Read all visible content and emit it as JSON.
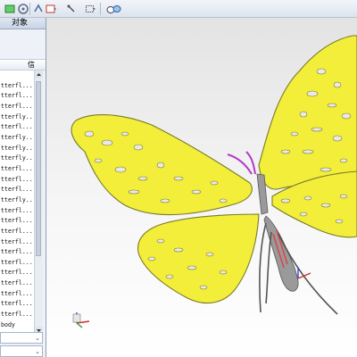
{
  "toolbar": {
    "icons": [
      "snap-icon",
      "orient-icon",
      "zoom-icon",
      "rotate-icon",
      "select-icon",
      "view-icon",
      "render-icon"
    ]
  },
  "navigator": {
    "title": "对象",
    "column_header": "信",
    "rows": [
      "",
      "tterfl...",
      "tterfl...",
      "tterfl...",
      "tterfly...",
      "tterfl...",
      "tterfly...",
      "tterfly...",
      "tterfly...",
      "tterfl...",
      "tterfl...",
      "tterfl...",
      "tterfly...",
      "tterfl...",
      "tterfl...",
      "tterfl...",
      "tterfl...",
      "tterfl...",
      "tterfl...",
      "tterfl...",
      "tterfl...",
      "tterfl...",
      "tterfl...",
      "tterfl...",
      "body"
    ]
  },
  "model": {
    "wing_color": "#f2ee3a",
    "outline_color": "#7b7a2b",
    "body_color": "#9a9a9a",
    "accent_color": "#b23cc8",
    "axis_colors": {
      "x": "#d42a2a",
      "y": "#22a33a",
      "z": "#2a4fd4"
    }
  }
}
